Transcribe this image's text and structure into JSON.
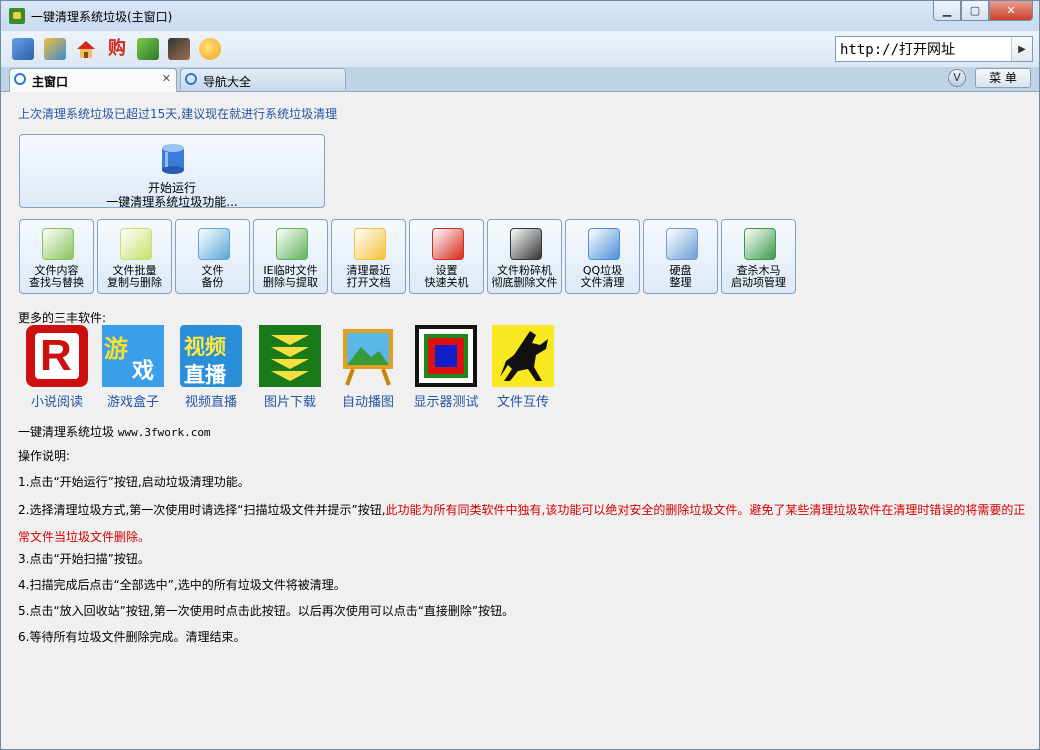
{
  "window": {
    "title": "一键清理系统垃圾(主窗口)",
    "min": "▁",
    "max": "▢",
    "close": "✕"
  },
  "toolbar": {
    "icons": [
      "settings-icon",
      "tools-icon",
      "home-icon",
      "shop-icon",
      "game-icon",
      "avatar-icon",
      "chat-icon"
    ],
    "url_value": "http://打开网址",
    "go": "▶"
  },
  "tabs": [
    {
      "label": "主窗口",
      "close": "✕"
    },
    {
      "label": "导航大全"
    }
  ],
  "tabbar": {
    "v": "V",
    "menu": "菜 单"
  },
  "main": {
    "notice": "上次清理系统垃圾已超过15天,建议现在就进行系统垃圾清理",
    "run": {
      "line1": "开始运行",
      "line2": "一键清理系统垃圾功能..."
    },
    "buttons": [
      {
        "l1": "文件内容",
        "l2": "查找与替换",
        "icon": "magnifier-file-icon",
        "color": "#8ac25a"
      },
      {
        "l1": "文件批量",
        "l2": "复制与删除",
        "icon": "copy-files-icon",
        "color": "#c7e06a"
      },
      {
        "l1": "文件",
        "l2": "备份",
        "icon": "backup-icon",
        "color": "#5aa7d8"
      },
      {
        "l1": "IE临时文件",
        "l2": "删除与提取",
        "icon": "recycle-icon",
        "color": "#5fb35a"
      },
      {
        "l1": "清理最近",
        "l2": "打开文档",
        "icon": "folder-icon",
        "color": "#f2c23a"
      },
      {
        "l1": "设置",
        "l2": "快速关机",
        "icon": "power-icon",
        "color": "#d6281c"
      },
      {
        "l1": "文件粉碎机",
        "l2": "彻底删除文件",
        "icon": "shredder-icon",
        "color": "#333333"
      },
      {
        "l1": "QQ垃圾",
        "l2": "文件清理",
        "icon": "qq-icon",
        "color": "#4a8fd8"
      },
      {
        "l1": "硬盘",
        "l2": "整理",
        "icon": "harddisk-icon",
        "color": "#6a9fd6"
      },
      {
        "l1": "查杀木马",
        "l2": "启动项管理",
        "icon": "shield-icon",
        "color": "#3a9a4a"
      }
    ],
    "more_label": "更多的三丰软件:",
    "software": [
      {
        "label": "小说阅读",
        "icon": "novel-icon"
      },
      {
        "label": "游戏盒子",
        "icon": "game-box-icon"
      },
      {
        "label": "视频直播",
        "icon": "video-live-icon"
      },
      {
        "label": "图片下载",
        "icon": "picture-download-icon"
      },
      {
        "label": "自动播图",
        "icon": "slideshow-icon"
      },
      {
        "label": "显示器测试",
        "icon": "monitor-test-icon"
      },
      {
        "label": "文件互传",
        "icon": "file-transfer-icon"
      }
    ],
    "game_text": "游",
    "game_text2": "戏",
    "video_text1": "视频",
    "video_text2": "直播",
    "about": "一键清理系统垃圾",
    "site": "www.3fwork.com",
    "instructions_title": "操作说明:",
    "step1": "1.点击“开始运行”按钮,启动垃圾清理功能。",
    "step2a": "2.选择清理垃圾方式,第一次使用时请选择“扫描垃圾文件并提示”按钮,",
    "step2b": "此功能为所有同类软件中独有,该功能可以绝对安全的删除垃圾文件。避免了某些清理垃圾软件在清理时错误的将需要的正常文件当垃圾文件删除。",
    "step3": "3.点击“开始扫描”按钮。",
    "step4": "4.扫描完成后点击“全部选中”,选中的所有垃圾文件将被清理。",
    "step5": "5.点击“放入回收站”按钮,第一次使用时点击此按钮。以后再次使用可以点击“直接删除”按钮。",
    "step6": "6.等待所有垃圾文件删除完成。清理结束。"
  }
}
